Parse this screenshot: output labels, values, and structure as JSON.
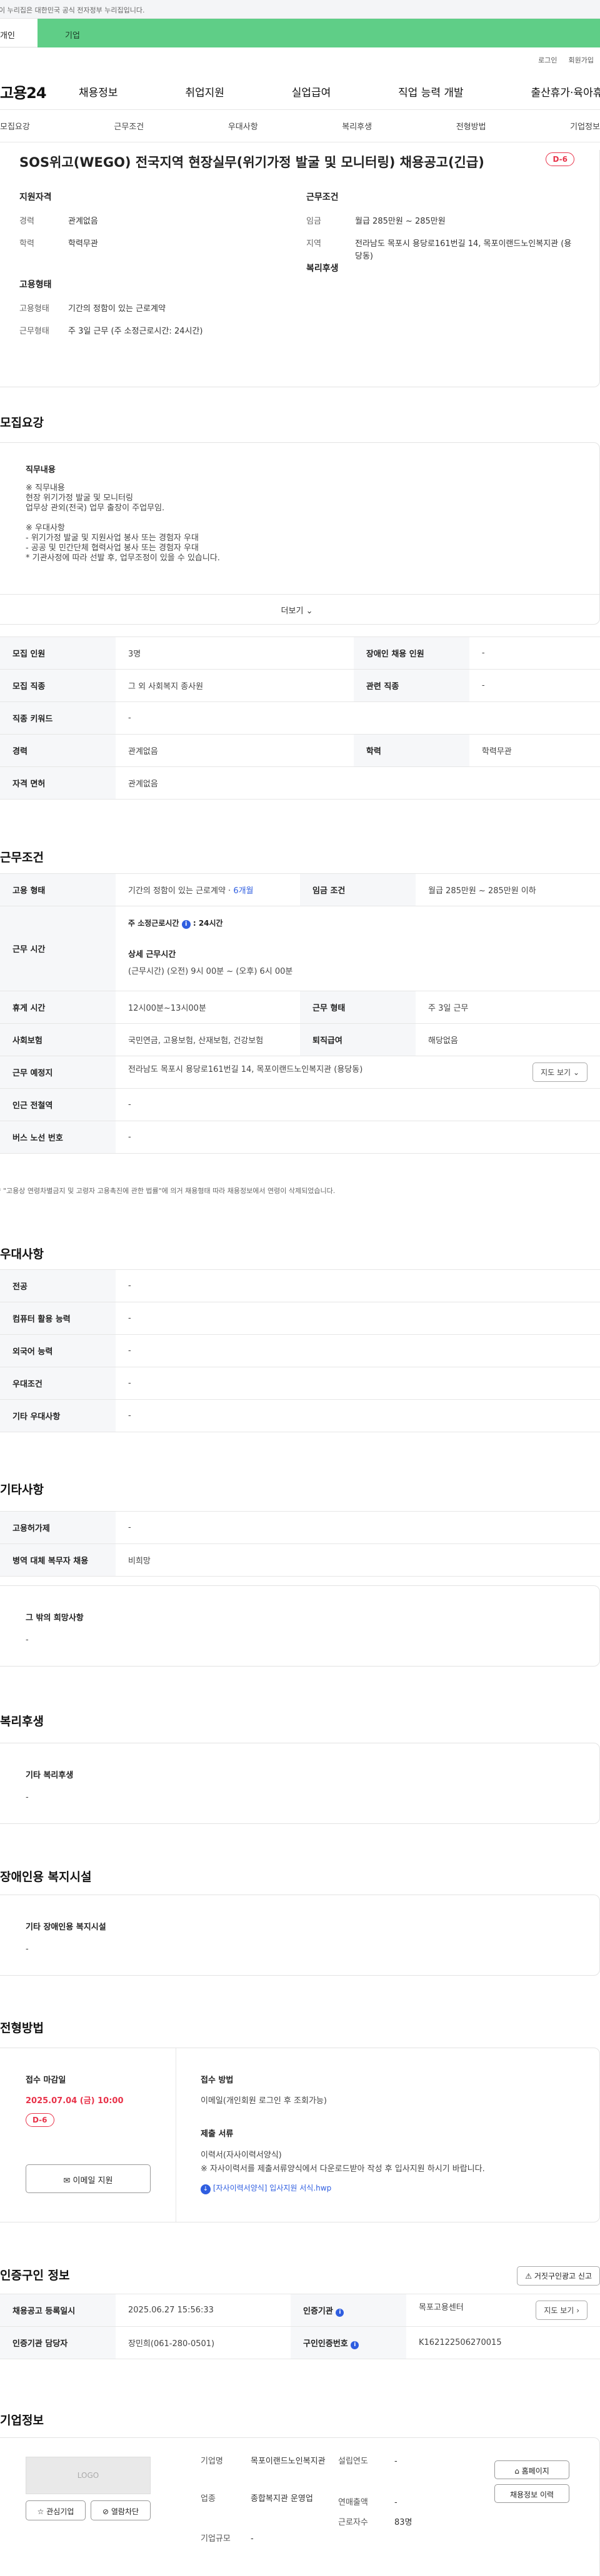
{
  "gov_banner": "이 누리집은 대한민국 공식 전자정부 누리집입니다.",
  "site_tabs": [
    "개인",
    "기업"
  ],
  "util_links": [
    "로그인",
    "회원가입"
  ],
  "logo": "고용24",
  "gnb": [
    "채용정보",
    "취업지원",
    "실업급여",
    "직업 능력 개발",
    "출산휴가·육아휴직"
  ],
  "subnav": [
    "모집요강",
    "근무조건",
    "우대사항",
    "복리후생",
    "전형방법",
    "기업정보"
  ],
  "job": {
    "title": "SOS위고(WEGO) 전국지역 현장실무(위기가정 발굴 및 모니터링) 채용공고(긴급)",
    "dday": "D-6"
  },
  "summary": {
    "qual_title": "지원자격",
    "cond_title": "근무조건",
    "emp_title": "고용형태",
    "welfare_title": "복리후생",
    "qual": [
      {
        "k": "경력",
        "v": "관계없음"
      },
      {
        "k": "학력",
        "v": "학력무관"
      }
    ],
    "cond": [
      {
        "k": "임금",
        "v": "월급 285만원 ~ 285만원"
      },
      {
        "k": "지역",
        "v": "전라남도 목포시 용당로161번길 14, 목포이랜드노인복지관 (용당동)"
      }
    ],
    "emp": [
      {
        "k": "고용형태",
        "v": "기간의 정함이 있는 근로계약"
      },
      {
        "k": "근무형태",
        "v": "주 3일 근무 (주 소정근로시간: 24시간)"
      }
    ]
  },
  "recruit": {
    "title": "모집요강",
    "desc_title": "직무내용",
    "desc": [
      "※ 직무내용",
      "현장 위기가정 발굴 및 모니터링",
      "업무상 관외(전국) 업무 출장이 주업무임.",
      "",
      "※ 우대사항",
      "- 위기가정 발굴 및 지원사업 봉사 또는 경험자 우대",
      "- 공공 및 민간단체 협력사업 봉사 또는 경험자 우대",
      "* 기관사정에 따라 선발 후, 업무조정이 있을 수 있습니다."
    ],
    "more": "더보기",
    "rows": [
      [
        {
          "k": "모집 인원",
          "v": "3명"
        },
        {
          "k": "장애인 채용 인원",
          "v": "-"
        }
      ],
      [
        {
          "k": "모집 직종",
          "v": "그 외 사회복지 종사원"
        },
        {
          "k": "관련 직종",
          "v": "-"
        }
      ],
      [
        {
          "k": "직종 키워드",
          "v": "-"
        }
      ],
      [
        {
          "k": "경력",
          "v": "관계없음"
        },
        {
          "k": "학력",
          "v": "학력무관"
        }
      ],
      [
        {
          "k": "자격 면허",
          "v": "관계없음"
        }
      ]
    ]
  },
  "condition": {
    "title": "근무조건",
    "emp_k": "고용 형태",
    "emp_v": "기간의 정함이 있는 근로계약 ·",
    "emp_months": "6개월",
    "pay_k": "임금 조건",
    "pay_v": "월급 285만원 ~ 285만원 이하",
    "time_k": "근무 시간",
    "hours_label": "주 소정근로시간",
    "hours_val": "24시간",
    "detail_label": "상세 근무시간",
    "detail_val": "(근무시간) (오전) 9시 00분 ~ (오후) 6시 00분",
    "break_k": "휴게 시간",
    "break_v": "12시00분~13시00분",
    "type_k": "근무 형태",
    "type_v": "주 3일 근무",
    "ins_k": "사회보험",
    "ins_v": "국민연금, 고용보험, 산재보험, 건강보험",
    "ret_k": "퇴직급여",
    "ret_v": "해당없음",
    "loc_k": "근무 예정지",
    "loc_v": "전라남도 목포시 용당로161번길 14, 목포이랜드노인복지관 (용당동)",
    "map_btn": "지도 보기",
    "subway_k": "인근 전철역",
    "subway_v": "-",
    "bus_k": "버스 노선 번호",
    "bus_v": "-",
    "note": "* \"고용상 연령차별금지 및 고령자 고용촉진에 관한 법률\"에 의거 채용형태 따라 채용정보에서 연령이 삭제되었습니다."
  },
  "preference": {
    "title": "우대사항",
    "rows": [
      {
        "k": "전공",
        "v": "-"
      },
      {
        "k": "컴퓨터 활용 능력",
        "v": "-"
      },
      {
        "k": "외국어 능력",
        "v": "-"
      },
      {
        "k": "우대조건",
        "v": "-"
      },
      {
        "k": "기타 우대사항",
        "v": "-"
      }
    ]
  },
  "etc": {
    "title": "기타사항",
    "rows": [
      {
        "k": "고용허가제",
        "v": "-"
      },
      {
        "k": "병역 대체 복무자 채용",
        "v": "비희망"
      }
    ],
    "box_title": "그 밖의 희망사항",
    "box_val": "-"
  },
  "welfare": {
    "title": "복리후생",
    "box_title": "기타 복리후생",
    "box_val": "-"
  },
  "disabled": {
    "title": "장애인용 복지시설",
    "box_title": "기타 장애인용 복지시설",
    "box_val": "-"
  },
  "process": {
    "title": "전형방법",
    "deadline_label": "접수 마감일",
    "deadline": "2025.07.04 (금) 10:00",
    "dday": "D-6",
    "apply_btn": "이메일 지원",
    "method_label": "접수 방법",
    "method_val": "이메일(개인회원 로그인 후 조회가능)",
    "doc_label": "제출 서류",
    "doc_lines": [
      "이력서(자사이력서양식)",
      "※ 자사이력서를 제출서류양식에서 다운로드받아 작성 후 입사지원 하시기 바랍니다."
    ],
    "doc_link": "[자사이력서양식] 입사지원 서식.hwp"
  },
  "cert": {
    "title": "인증구인 정보",
    "report_btn": "거짓구인광고 신고",
    "r1": [
      {
        "k": "채용공고 등록일시",
        "v": "2025.06.27 15:56:33"
      },
      {
        "k": "인증기관",
        "v": "목포고용센터"
      }
    ],
    "map_btn": "지도 보기",
    "r2": [
      {
        "k": "인증기관 담당자",
        "v": "장민희(061-280-0501)"
      },
      {
        "k": "구인인증번호",
        "v": "K162122506270015"
      }
    ]
  },
  "company": {
    "title": "기업정보",
    "logo": "LOGO",
    "fav_btn": "관심기업",
    "block_btn": "열람차단",
    "info": [
      {
        "k": "기업명",
        "v": "목포이랜드노인복지관"
      },
      {
        "k": "설립연도",
        "v": "-"
      },
      {
        "k": "업종",
        "v": "종합복지관 운영업"
      },
      {
        "k": "연매출액",
        "v": "-"
      },
      {
        "k": "근로자수",
        "v": "83명"
      },
      {
        "k": "기업규모",
        "v": "-"
      }
    ],
    "home_btn": "홈페이지",
    "list_btn": "채용정보 이력"
  },
  "colors": {
    "accent": "#5fce87",
    "dday": "#e8334a",
    "link": "#2f5ee0"
  }
}
